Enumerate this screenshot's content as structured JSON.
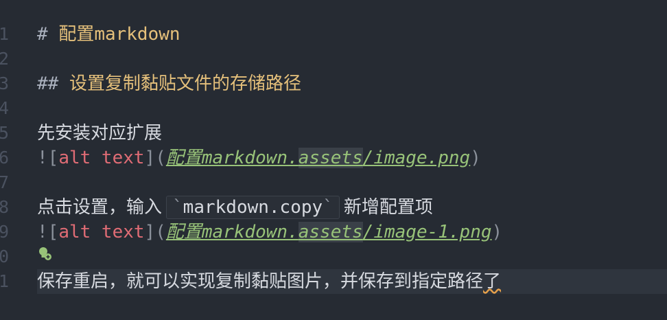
{
  "lines": [
    {
      "n": "1"
    },
    {
      "n": "2"
    },
    {
      "n": "3"
    },
    {
      "n": "4"
    },
    {
      "n": "5"
    },
    {
      "n": "6"
    },
    {
      "n": "7"
    },
    {
      "n": "8"
    },
    {
      "n": "9"
    },
    {
      "n": "0"
    },
    {
      "n": "1"
    }
  ],
  "content": {
    "h1_mark": "#",
    "h1_text": "配置markdown",
    "h2_mark": "##",
    "h2_text": "设置复制黏贴文件的存储路径",
    "line5": "先安装对应扩展",
    "img1": {
      "bang": "!",
      "lb": "[",
      "alt": "alt text",
      "rb": "]",
      "lp": "(",
      "path_a": "配置markdown.",
      "path_b": "assets",
      "path_c": "/image.png",
      "rp": ")"
    },
    "line8_pre": "点击设置，输入",
    "line8_code": "markdown.copy",
    "line8_post": "新增配置项",
    "img2": {
      "bang": "!",
      "lb": "[",
      "alt": "alt text",
      "rb": "]",
      "lp": "(",
      "path_a": "配置markdown.",
      "path_b": "assets",
      "path_c": "/image-1.png",
      "rp": ")"
    },
    "line11_a": "保存重启，就可以实现复制黏贴图片，并保存到指定路径",
    "line11_b": "了"
  },
  "colors": {
    "background": "#262b33",
    "heading": "#e5c07b",
    "alt_text": "#e06c75",
    "link": "#98c379",
    "lightbulb": "#98c379"
  },
  "icons": [
    "lightbulb-icon"
  ]
}
